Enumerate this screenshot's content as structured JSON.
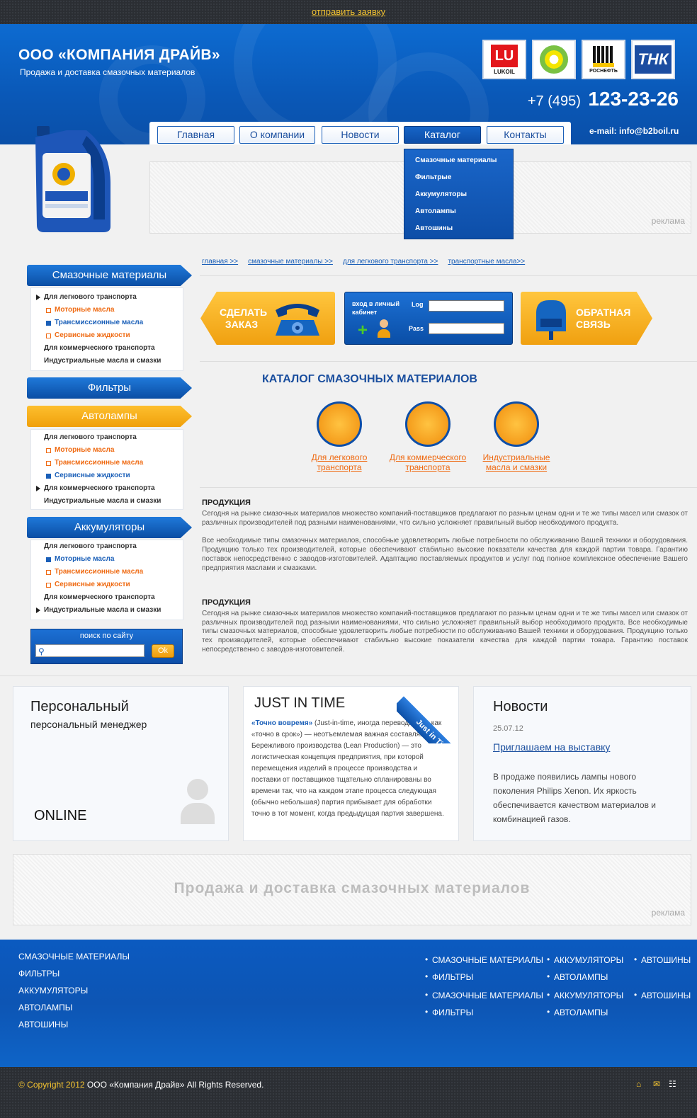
{
  "topbar": {
    "link": "отправить заявку"
  },
  "header": {
    "company": "ООО «КОМПАНИЯ ДРАЙВ»",
    "subtitle": "Продажа и доставка смазочных материалов",
    "logos": [
      "LUKOIL",
      "BP",
      "РОСНЕФТЬ",
      "ТНК"
    ],
    "phone_prefix": "+7 (495)",
    "phone_number": "123-23-26",
    "email": "e-mail: info@b2boil.ru"
  },
  "nav": {
    "items": [
      "Главная",
      "О компании",
      "Новости",
      "Каталог",
      "Контакты"
    ],
    "dropdown": [
      "Смазочные материалы",
      "Фильтрые",
      "Аккумуляторы",
      "Автолампы",
      "Автошины"
    ]
  },
  "ads": {
    "label": "реклама",
    "big_text": "Продажа и доставка смазочных материалов"
  },
  "breadcrumbs": [
    "главная >>",
    "смазочные материалы >>",
    "для легкового транспорта >>",
    "транспортные масла>>"
  ],
  "sidebar": {
    "cat1": "Смазочные материалы",
    "cat1_items": [
      "Для легкового транспорта",
      "Моторные масла",
      "Трансмиссионные масла",
      "Сервисные жидкости",
      "Для коммерческого транспорта",
      "Индустриальные масла и смазки"
    ],
    "cat2": "Фильтры",
    "cat3": "Автолампы",
    "cat3_items": [
      "Для легкового транспорта",
      "Моторные масла",
      "Трансмиссионные масла",
      "Сервисные жидкости",
      "Для коммерческого транспорта",
      "Индустриальные масла и смазки"
    ],
    "cat4": "Аккумуляторы",
    "cat4_items": [
      "Для легкового транспорта",
      "Моторные масла",
      "Трансмиссионные масла",
      "Сервисные жидкости",
      "Для коммерческого транспорта",
      "Индустриальные масла и смазки"
    ],
    "search_title": "поиск по сайту",
    "search_ok": "Ok"
  },
  "actions": {
    "order": "СДЕЛАТЬ ЗАКАЗ",
    "cabinet": "вход в личный кабинет",
    "login_label": "Log",
    "pass_label": "Pass",
    "feedback": "ОБРАТНАЯ СВЯЗЬ"
  },
  "catalog": {
    "title": "КАТАЛОГ СМАЗОЧНЫХ МАТЕРИАЛОВ",
    "items": [
      "Для легкового транспорта",
      "Для коммерческого транспорта",
      "Индустриальные масла и смазки"
    ]
  },
  "text": {
    "h1": "ПРОДУКЦИЯ",
    "p1": "Сегодня на рынке смазочных материалов множество компаний-поставщиков предлагают по разным ценам одни и те же типы масел или смазок от различных производителей под разными наименованиями, что сильно усложняет правильный  выбор необходимого продукта.",
    "p2": "Все необходимые типы смазочных материалов, способные удовлетворить любые потребности по обслуживанию Вашей техники и оборудования. Продукцию только тех производителей, которые обеспечивают стабильно высокие показатели качества для каждой партии товара. Гарантию поставок непосредственно с заводов-изготовителей. Адаптацию поставляемых продуктов и услуг под полное комплексное обеспечение Вашего предприятия маслами и смазками.",
    "h2": "ПРОДУКЦИЯ",
    "p3": "Сегодня на рынке смазочных материалов множество компаний-поставщиков предлагают по разным ценам одни и те же типы масел или смазок от различных производителей под разными наименованиями, что сильно усложняет правильный  выбор необходимого продукта. Все необходимые типы смазочных материалов, способные удовлетворить любые потребности по обслуживанию Вашей техники и оборудования. Продукцию только тех производителей, которые обеспечивают стабильно высокие показатели качества для каждой партии товара. Гарантию поставок непосредственно с заводов-изготовителей."
  },
  "panels": {
    "personal_title": "Персональный",
    "personal_sub": "персональный менеджер",
    "personal_online": "ONLINE",
    "jit_title": "JUST IN TIME",
    "jit_ribbon": "Just in Time",
    "jit_lead": "«Точно вовремя»",
    "jit_text": " (Just-in-time, иногда переводится и как «точно в срок») — неотъемлемая важная составляющая Бережливого производства (Lean Production) — это логистическая концепция предприятия, при которой перемещения изделий в процессе производства и поставки от поставщиков тщательно спланированы во времени так, что на каждом этапе процесса следующая (обычно небольшая) партия прибывает для обработки точно в тот момент, когда предыдущая партия завершена.",
    "news_title": "Новости",
    "news_date": "25.07.12",
    "news_link": "Приглашаем на выставку",
    "news_text": "В продаже появились лампы нового поколения Philips Xenon. Их яркость обеспечивается качеством материалов и комбинацией газов."
  },
  "footer": {
    "left": [
      "СМАЗОЧНЫЕ МАТЕРИАЛЫ",
      "ФИЛЬТРЫ",
      "АККУМУЛЯТОРЫ",
      "АВТОЛАМПЫ",
      "АВТОШИНЫ"
    ],
    "col1": [
      "СМАЗОЧНЫЕ МАТЕРИАЛЫ",
      "ФИЛЬТРЫ",
      "СМАЗОЧНЫЕ МАТЕРИАЛЫ",
      "ФИЛЬТРЫ"
    ],
    "col2": [
      "АККУМУЛЯТОРЫ",
      "АВТОЛАМПЫ",
      "АККУМУЛЯТОРЫ",
      "АВТОЛАМПЫ"
    ],
    "col3": [
      "АВТОШИНЫ",
      "АВТОШИНЫ"
    ],
    "copyright": "© Copyright 2012",
    "rights": "ООО «Компания Драйв»  All Rights Reserved."
  },
  "colors": {
    "brand_blue": "#0d5bbf",
    "accent_orange": "#f0a010",
    "link_orange": "#ef6a12",
    "topbar": "#2b2e33"
  }
}
